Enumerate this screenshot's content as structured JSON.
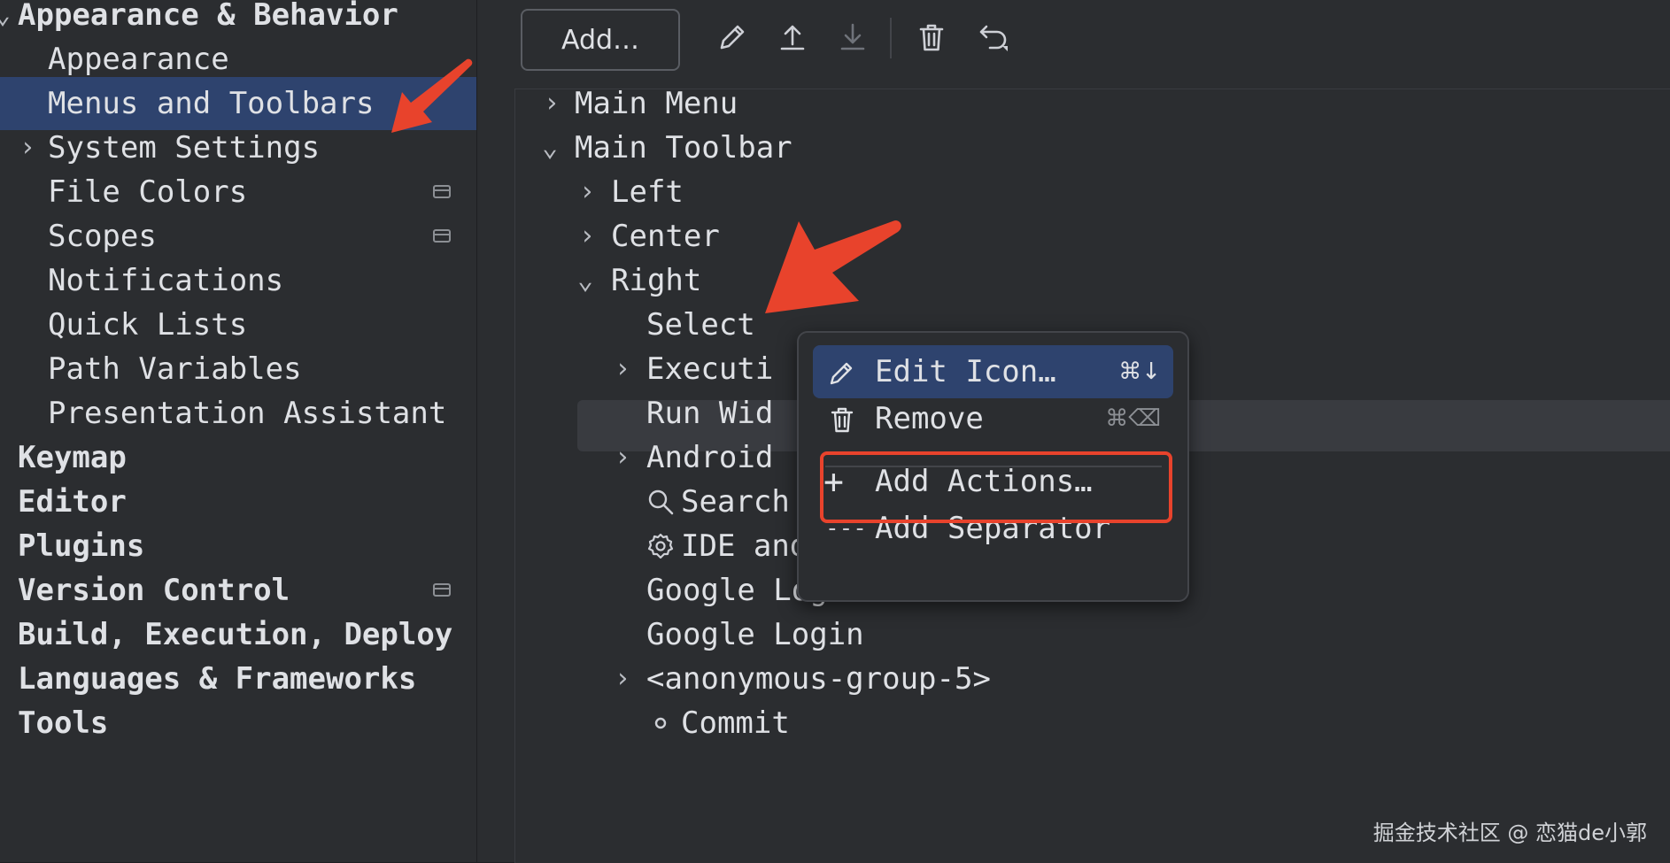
{
  "sidebar": {
    "items": [
      {
        "label": "Appearance & Behavior",
        "bold": true,
        "chevron": "⌄"
      },
      {
        "label": "Appearance"
      },
      {
        "label": "Menus and Toolbars",
        "selected": true
      },
      {
        "label": "System Settings",
        "chevron": "›"
      },
      {
        "label": "File Colors",
        "project_icon": true
      },
      {
        "label": "Scopes",
        "project_icon": true
      },
      {
        "label": "Notifications"
      },
      {
        "label": "Quick Lists"
      },
      {
        "label": "Path Variables"
      },
      {
        "label": "Presentation Assistant"
      },
      {
        "label": "Keymap",
        "bold": true
      },
      {
        "label": "Editor",
        "bold": true
      },
      {
        "label": "Plugins",
        "bold": true
      },
      {
        "label": "Version Control",
        "bold": true,
        "project_icon": true
      },
      {
        "label": "Build, Execution, Deploy",
        "bold": true
      },
      {
        "label": "Languages & Frameworks",
        "bold": true
      },
      {
        "label": "Tools",
        "bold": true
      }
    ]
  },
  "toolbar": {
    "add_label": "Add…",
    "icons": [
      "edit-icon",
      "move-up-icon",
      "move-down-icon",
      "delete-icon",
      "restore-icon"
    ]
  },
  "tree": {
    "rows": [
      {
        "label": "Main Menu",
        "chevron": "›"
      },
      {
        "label": "Main Toolbar",
        "chevron": "⌄"
      },
      {
        "label": "Left",
        "chevron": "›"
      },
      {
        "label": "Center",
        "chevron": "›"
      },
      {
        "label": "Right",
        "chevron": "⌄",
        "highlighted": true
      },
      {
        "label": "Select"
      },
      {
        "label": "Executi",
        "chevron": "›"
      },
      {
        "label": "Run Wid"
      },
      {
        "label": "Android",
        "chevron": "›"
      },
      {
        "label": "Search Everywhere",
        "icon": "search-icon"
      },
      {
        "label": "IDE and Project Settings",
        "icon": "gear-icon"
      },
      {
        "label": "Google Login V2"
      },
      {
        "label": "Google Login"
      },
      {
        "label": "<anonymous-group-5>",
        "chevron": "›"
      },
      {
        "label": "Commit",
        "icon": "commit-icon"
      }
    ]
  },
  "popup": {
    "items": [
      {
        "label": "Edit Icon…",
        "shortcut": "⌘↓",
        "icon": "pencil-icon",
        "selected": true
      },
      {
        "label": "Remove",
        "shortcut": "⌘⌫",
        "icon": "trash-icon"
      },
      {
        "label": "Add Actions…",
        "icon": "plus-icon",
        "prefix": "+"
      },
      {
        "label": "Add Separator",
        "icon": "separator-icon",
        "prefix": "---"
      }
    ]
  },
  "colors": {
    "selection": "#2e436e",
    "annotation": "#e8432c"
  },
  "watermark": "掘金技术社区 @ 恋猫de小郭"
}
